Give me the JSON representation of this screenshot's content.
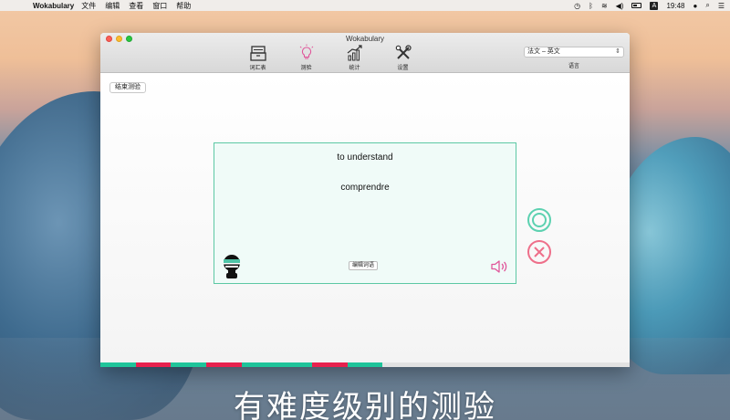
{
  "menubar": {
    "app_name": "Wokabulary",
    "menus": [
      "文件",
      "编辑",
      "查看",
      "窗口",
      "帮助"
    ],
    "time": "19:48"
  },
  "window": {
    "title": "Wokabulary",
    "toolbar": [
      {
        "label": "词汇表",
        "icon": "vocabulary-box-icon"
      },
      {
        "label": "测验",
        "icon": "lightbulb-icon"
      },
      {
        "label": "统计",
        "icon": "chart-icon"
      },
      {
        "label": "设置",
        "icon": "tools-icon"
      }
    ],
    "language": {
      "value": "法文 – 英文",
      "label": "语言"
    }
  },
  "quiz": {
    "end_button": "结束测验",
    "term": "to understand",
    "translation": "comprendre",
    "edit_button": "编辑词语",
    "progress": [
      "correct",
      "wrong",
      "correct",
      "wrong",
      "correct",
      "correct",
      "wrong",
      "correct",
      "remaining",
      "remaining",
      "remaining",
      "remaining",
      "remaining",
      "remaining",
      "remaining"
    ]
  },
  "colors": {
    "correct": "#1fc49a",
    "wrong": "#e8214e",
    "remaining": "#e2e2e2",
    "accent_pink": "#e0569a"
  },
  "caption": "有难度级别的测验"
}
